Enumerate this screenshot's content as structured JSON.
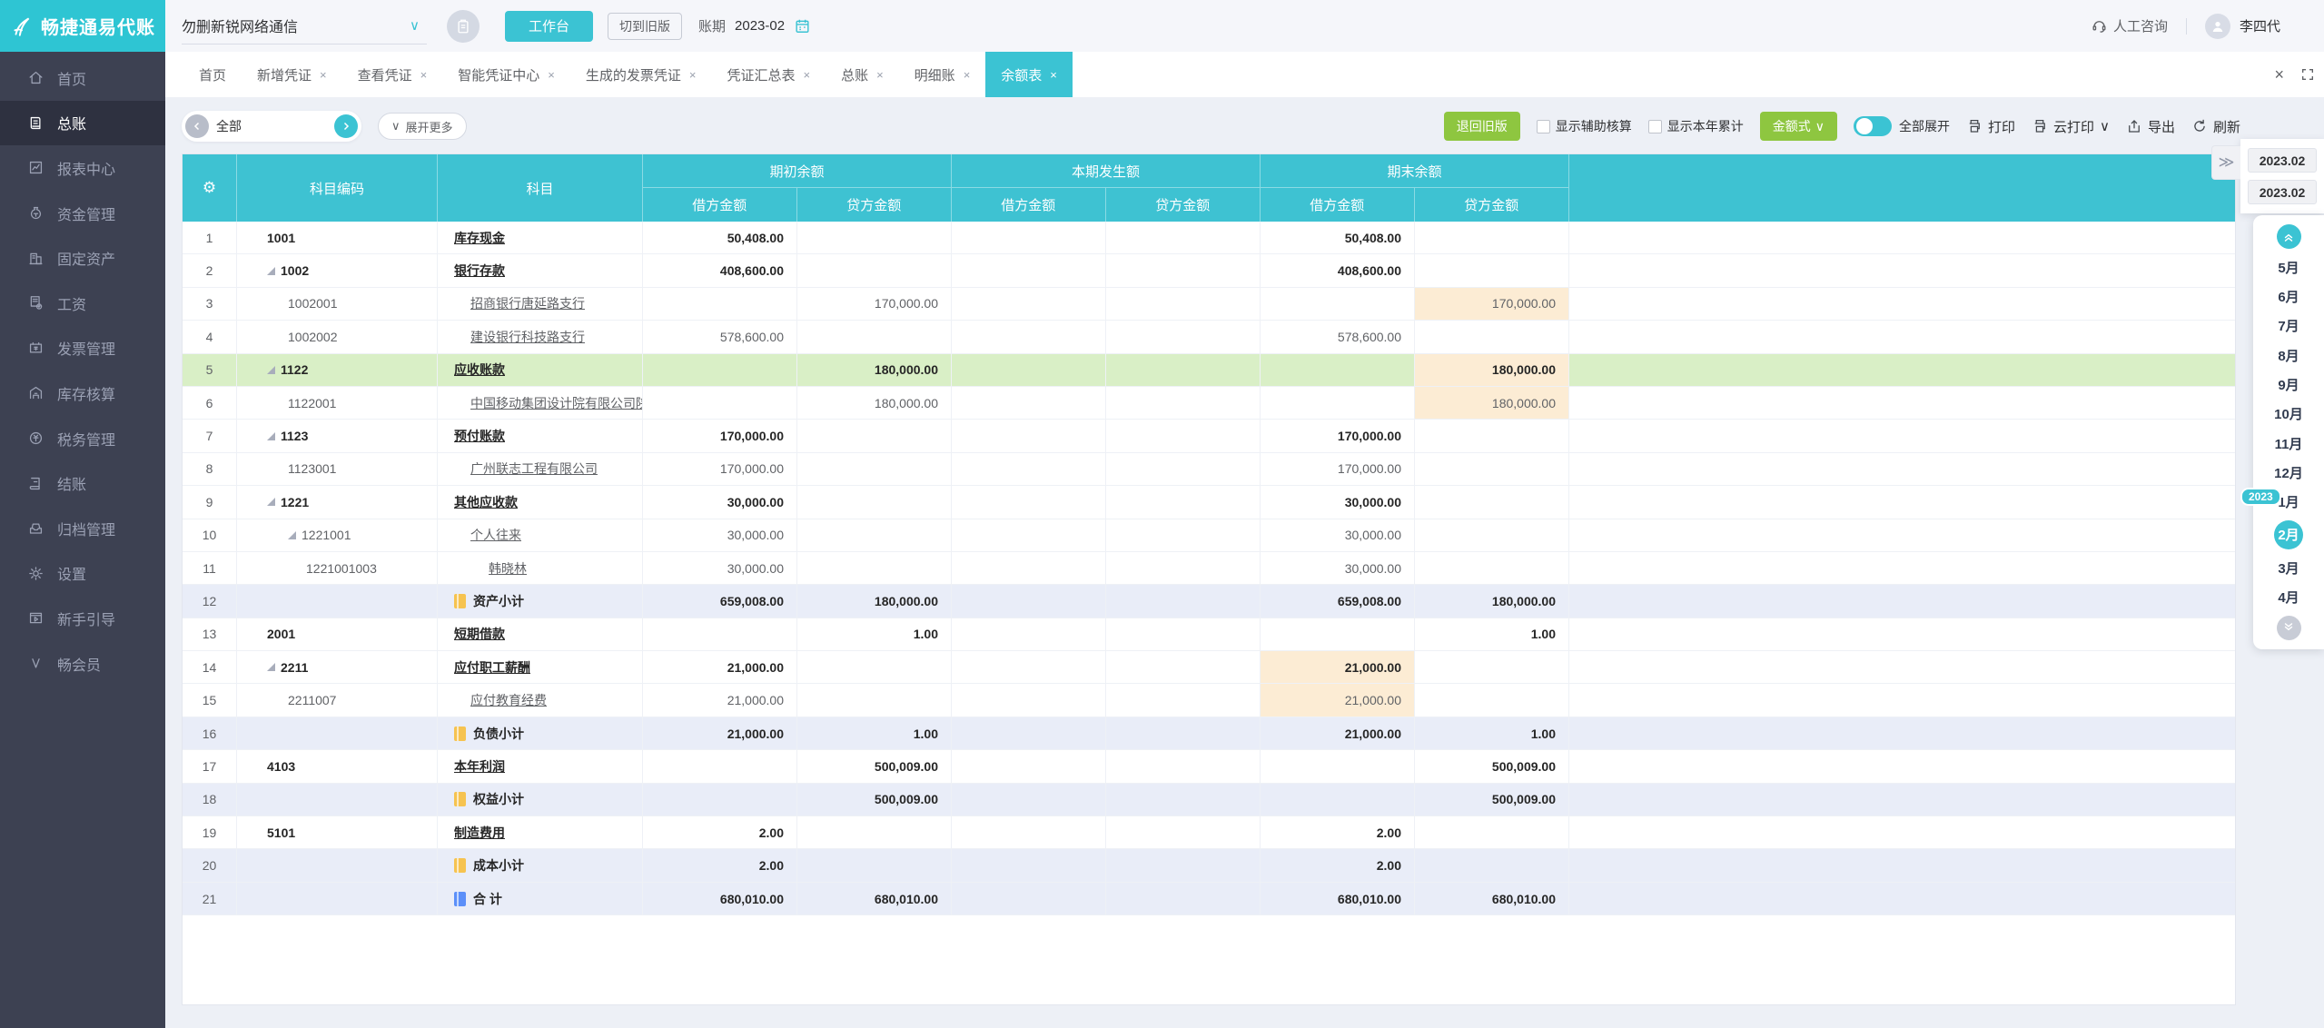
{
  "brand": {
    "logo": "畅捷通易代账"
  },
  "topbar": {
    "company": "勿删新锐网络通信",
    "workbench_btn": "工作台",
    "switch_old_btn": "切到旧版",
    "period_label": "账期",
    "period_value": "2023-02",
    "support": "人工咨询",
    "user": "李四代"
  },
  "sidebar": {
    "items": [
      {
        "id": "home",
        "label": "首页",
        "icon": "home",
        "active": false
      },
      {
        "id": "general-ledger",
        "label": "总账",
        "icon": "ledger",
        "active": true
      },
      {
        "id": "report-center",
        "label": "报表中心",
        "icon": "report",
        "active": false
      },
      {
        "id": "funds",
        "label": "资金管理",
        "icon": "funds",
        "active": false
      },
      {
        "id": "fixed-assets",
        "label": "固定资产",
        "icon": "assets",
        "active": false
      },
      {
        "id": "salary",
        "label": "工资",
        "icon": "salary",
        "active": false
      },
      {
        "id": "invoice",
        "label": "发票管理",
        "icon": "invoice",
        "active": false
      },
      {
        "id": "inventory",
        "label": "库存核算",
        "icon": "inventory",
        "active": false
      },
      {
        "id": "tax",
        "label": "税务管理",
        "icon": "tax",
        "active": false
      },
      {
        "id": "closing",
        "label": "结账",
        "icon": "closing",
        "active": false
      },
      {
        "id": "archive",
        "label": "归档管理",
        "icon": "archive",
        "active": false
      },
      {
        "id": "settings",
        "label": "设置",
        "icon": "settings",
        "active": false
      },
      {
        "id": "guide",
        "label": "新手引导",
        "icon": "guide",
        "active": false
      },
      {
        "id": "member",
        "label": "畅会员",
        "icon": "member",
        "active": false
      }
    ]
  },
  "tabs": {
    "items": [
      {
        "label": "首页",
        "closable": false,
        "active": false
      },
      {
        "label": "新增凭证",
        "closable": true,
        "active": false
      },
      {
        "label": "查看凭证",
        "closable": true,
        "active": false
      },
      {
        "label": "智能凭证中心",
        "closable": true,
        "active": false
      },
      {
        "label": "生成的发票凭证",
        "closable": true,
        "active": false
      },
      {
        "label": "凭证汇总表",
        "closable": true,
        "active": false
      },
      {
        "label": "总账",
        "closable": true,
        "active": false
      },
      {
        "label": "明细账",
        "closable": true,
        "active": false
      },
      {
        "label": "余额表",
        "closable": true,
        "active": true
      }
    ]
  },
  "toolbar": {
    "scope_value": "全部",
    "expand_more": "展开更多",
    "back_old": "退回旧版",
    "checkbox_aux": "显示辅助核算",
    "checkbox_ytd": "显示本年累计",
    "amount_style": "金额式",
    "expand_all": "全部展开",
    "print": "打印",
    "cloud_print": "云打印",
    "export": "导出",
    "refresh": "刷新"
  },
  "table": {
    "header": {
      "code_label": "科目编码",
      "subject_label": "科目",
      "groups": [
        {
          "label": "期初余额"
        },
        {
          "label": "本期发生额"
        },
        {
          "label": "期末余额"
        }
      ],
      "debit_label": "借方金额",
      "credit_label": "贷方金额"
    },
    "rows": [
      {
        "num": 1,
        "code": "1001",
        "name": "库存现金",
        "level": 1,
        "bold": true,
        "tri": false,
        "type": "normal",
        "amounts": [
          "50,408.00",
          "",
          "",
          "",
          "50,408.00",
          ""
        ],
        "hl": []
      },
      {
        "num": 2,
        "code": "1002",
        "name": "银行存款",
        "level": 1,
        "bold": true,
        "tri": true,
        "type": "normal",
        "amounts": [
          "408,600.00",
          "",
          "",
          "",
          "408,600.00",
          ""
        ],
        "hl": []
      },
      {
        "num": 3,
        "code": "1002001",
        "name": "招商银行唐延路支行",
        "level": 2,
        "bold": false,
        "tri": false,
        "type": "normal",
        "amounts": [
          "",
          "170,000.00",
          "",
          "",
          "",
          "170,000.00"
        ],
        "hl": [
          5
        ]
      },
      {
        "num": 4,
        "code": "1002002",
        "name": "建设银行科技路支行",
        "level": 2,
        "bold": false,
        "tri": false,
        "type": "normal",
        "amounts": [
          "578,600.00",
          "",
          "",
          "",
          "578,600.00",
          ""
        ],
        "hl": []
      },
      {
        "num": 5,
        "code": "1122",
        "name": "应收账款",
        "level": 1,
        "bold": true,
        "tri": true,
        "type": "selected",
        "amounts": [
          "",
          "180,000.00",
          "",
          "",
          "",
          "180,000.00"
        ],
        "hl": [
          5
        ]
      },
      {
        "num": 6,
        "code": "1122001",
        "name": "中国移动集团设计院有限公司陕西",
        "level": 2,
        "bold": false,
        "tri": false,
        "type": "normal",
        "amounts": [
          "",
          "180,000.00",
          "",
          "",
          "",
          "180,000.00"
        ],
        "hl": [
          5
        ]
      },
      {
        "num": 7,
        "code": "1123",
        "name": "预付账款",
        "level": 1,
        "bold": true,
        "tri": true,
        "type": "normal",
        "amounts": [
          "170,000.00",
          "",
          "",
          "",
          "170,000.00",
          ""
        ],
        "hl": []
      },
      {
        "num": 8,
        "code": "1123001",
        "name": "广州联志工程有限公司",
        "level": 2,
        "bold": false,
        "tri": false,
        "type": "normal",
        "amounts": [
          "170,000.00",
          "",
          "",
          "",
          "170,000.00",
          ""
        ],
        "hl": []
      },
      {
        "num": 9,
        "code": "1221",
        "name": "其他应收款",
        "level": 1,
        "bold": true,
        "tri": true,
        "type": "normal",
        "amounts": [
          "30,000.00",
          "",
          "",
          "",
          "30,000.00",
          ""
        ],
        "hl": []
      },
      {
        "num": 10,
        "code": "1221001",
        "name": "个人往来",
        "level": 2,
        "bold": false,
        "tri": true,
        "type": "normal",
        "amounts": [
          "30,000.00",
          "",
          "",
          "",
          "30,000.00",
          ""
        ],
        "hl": []
      },
      {
        "num": 11,
        "code": "1221001003",
        "name": "韩晓林",
        "level": 3,
        "bold": false,
        "tri": false,
        "type": "normal",
        "amounts": [
          "30,000.00",
          "",
          "",
          "",
          "30,000.00",
          ""
        ],
        "hl": []
      },
      {
        "num": 12,
        "code": "",
        "name": "资产小计",
        "level": 1,
        "bold": true,
        "tri": false,
        "type": "subtotal",
        "icon": "yellow",
        "amounts": [
          "659,008.00",
          "180,000.00",
          "",
          "",
          "659,008.00",
          "180,000.00"
        ],
        "hl": []
      },
      {
        "num": 13,
        "code": "2001",
        "name": "短期借款",
        "level": 1,
        "bold": true,
        "tri": false,
        "type": "normal",
        "amounts": [
          "",
          "1.00",
          "",
          "",
          "",
          "1.00"
        ],
        "hl": []
      },
      {
        "num": 14,
        "code": "2211",
        "name": "应付职工薪酬",
        "level": 1,
        "bold": true,
        "tri": true,
        "type": "normal",
        "amounts": [
          "21,000.00",
          "",
          "",
          "",
          "21,000.00",
          ""
        ],
        "hl": [
          4
        ]
      },
      {
        "num": 15,
        "code": "2211007",
        "name": "应付教育经费",
        "level": 2,
        "bold": false,
        "tri": false,
        "type": "normal",
        "amounts": [
          "21,000.00",
          "",
          "",
          "",
          "21,000.00",
          ""
        ],
        "hl": [
          4
        ]
      },
      {
        "num": 16,
        "code": "",
        "name": "负债小计",
        "level": 1,
        "bold": true,
        "tri": false,
        "type": "subtotal",
        "icon": "yellow",
        "amounts": [
          "21,000.00",
          "1.00",
          "",
          "",
          "21,000.00",
          "1.00"
        ],
        "hl": []
      },
      {
        "num": 17,
        "code": "4103",
        "name": "本年利润",
        "level": 1,
        "bold": true,
        "tri": false,
        "type": "normal",
        "amounts": [
          "",
          "500,009.00",
          "",
          "",
          "",
          "500,009.00"
        ],
        "hl": []
      },
      {
        "num": 18,
        "code": "",
        "name": "权益小计",
        "level": 1,
        "bold": true,
        "tri": false,
        "type": "subtotal",
        "icon": "yellow",
        "amounts": [
          "",
          "500,009.00",
          "",
          "",
          "",
          "500,009.00"
        ],
        "hl": []
      },
      {
        "num": 19,
        "code": "5101",
        "name": "制造费用",
        "level": 1,
        "bold": true,
        "tri": false,
        "type": "normal",
        "amounts": [
          "2.00",
          "",
          "",
          "",
          "2.00",
          ""
        ],
        "hl": []
      },
      {
        "num": 20,
        "code": "",
        "name": "成本小计",
        "level": 1,
        "bold": true,
        "tri": false,
        "type": "subtotal",
        "icon": "yellow",
        "amounts": [
          "2.00",
          "",
          "",
          "",
          "2.00",
          ""
        ],
        "hl": []
      },
      {
        "num": 21,
        "code": "",
        "name": "合 计",
        "level": 1,
        "bold": true,
        "tri": false,
        "type": "total",
        "icon": "blue",
        "amounts": [
          "680,010.00",
          "680,010.00",
          "",
          "",
          "680,010.00",
          "680,010.00"
        ],
        "hl": []
      }
    ]
  },
  "period_panel": {
    "dates": [
      "2023.02",
      "2023.02"
    ],
    "year_badge": "2023",
    "badge_before": "1月",
    "months": [
      {
        "label": "5月",
        "active": false
      },
      {
        "label": "6月",
        "active": false
      },
      {
        "label": "7月",
        "active": false
      },
      {
        "label": "8月",
        "active": false
      },
      {
        "label": "9月",
        "active": false
      },
      {
        "label": "10月",
        "active": false
      },
      {
        "label": "11月",
        "active": false
      },
      {
        "label": "12月",
        "active": false
      },
      {
        "label": "1月",
        "active": false
      },
      {
        "label": "2月",
        "active": true
      },
      {
        "label": "3月",
        "active": false
      },
      {
        "label": "4月",
        "active": false
      }
    ]
  },
  "icons": {
    "chevron_down": "∨",
    "close": "×",
    "gear": "⚙",
    "double_right": "≫"
  },
  "colors": {
    "teal": "#3bc3d3",
    "green": "#8ec640",
    "sidebar_bg": "#3d4152",
    "selected_row": "#d9efc6",
    "subtotal_row": "#e9edf8",
    "highlight_cell": "#fcecd4"
  }
}
